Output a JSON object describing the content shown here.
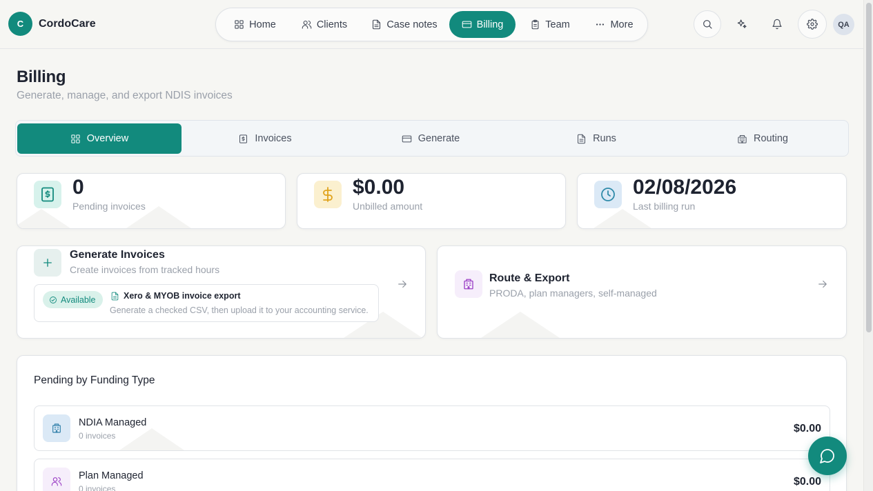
{
  "brand": {
    "logo_letter": "C",
    "name": "CordoCare"
  },
  "nav": {
    "items": [
      {
        "label": "Home",
        "icon": "grid-icon"
      },
      {
        "label": "Clients",
        "icon": "users-icon"
      },
      {
        "label": "Case notes",
        "icon": "file-text-icon"
      },
      {
        "label": "Billing",
        "icon": "credit-card-icon",
        "active": true
      },
      {
        "label": "Team",
        "icon": "clipboard-icon"
      },
      {
        "label": "More",
        "icon": "more-icon"
      }
    ]
  },
  "header_actions": {
    "avatar_initials": "QA"
  },
  "page": {
    "title": "Billing",
    "subtitle": "Generate, manage, and export NDIS invoices"
  },
  "tabs": [
    {
      "label": "Overview",
      "active": true
    },
    {
      "label": "Invoices"
    },
    {
      "label": "Generate"
    },
    {
      "label": "Runs"
    },
    {
      "label": "Routing"
    }
  ],
  "stats": [
    {
      "value": "0",
      "label": "Pending invoices",
      "icon": "invoice-dollar-icon"
    },
    {
      "value": "$0.00",
      "label": "Unbilled amount",
      "icon": "dollar-icon"
    },
    {
      "value": "02/08/2026",
      "label": "Last billing run",
      "icon": "clock-icon"
    }
  ],
  "generate": {
    "title": "Generate Invoices",
    "subtitle": "Create invoices from tracked hours",
    "badge": "Available",
    "export_title": "Xero & MYOB invoice export",
    "export_desc": "Generate a checked CSV, then upload it to your accounting service."
  },
  "route": {
    "title": "Route & Export",
    "subtitle": "PRODA, plan managers, self-managed"
  },
  "pending": {
    "title": "Pending by Funding Type",
    "rows": [
      {
        "name": "NDIA Managed",
        "count": "0 invoices",
        "amount": "$0.00"
      },
      {
        "name": "Plan Managed",
        "count": "0 invoices",
        "amount": "$0.00"
      }
    ]
  },
  "colors": {
    "accent": "#128a7d",
    "background": "#f6f6f3",
    "muted_text": "#9aa0aa"
  }
}
